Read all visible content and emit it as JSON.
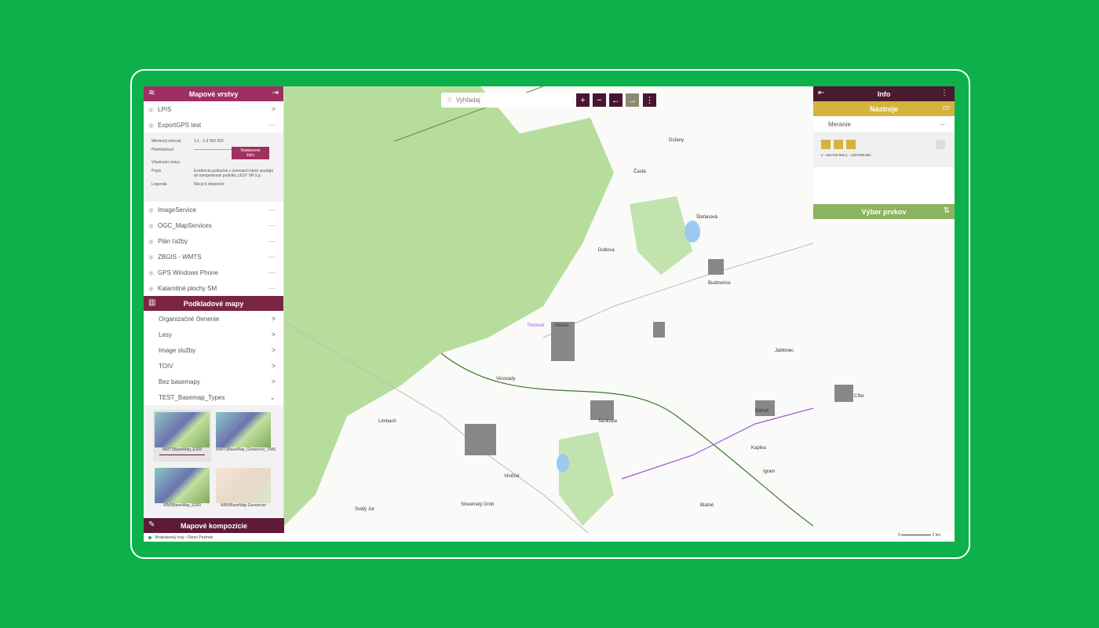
{
  "left": {
    "layers_title": "Mapové vrstvy",
    "layers": [
      {
        "label": "LPIS",
        "action": ">"
      },
      {
        "label": "ExportGPS test",
        "action": "···"
      }
    ],
    "detail": {
      "scale_label": "Mierkový interval",
      "scale_value": "1:1 - 1:3 000 000",
      "opacity_label": "Priehľadnosť",
      "settings_button": "Nastavenie štýlu",
      "props_label": "Vlastnosti vrstvy",
      "desc_label": "Popis",
      "desc_value": "Evidencia požiarísk v územiach ktoré spadajú do kompetencie podniku LESY SR š.p.",
      "legend_label": "Legenda",
      "legend_value": "Nie je k dispozícii",
      "opacity": 0.95
    },
    "layers2": [
      {
        "label": "ImageService"
      },
      {
        "label": "OGC_MapServices"
      },
      {
        "label": "Plán ťažby"
      },
      {
        "label": "ZBGIS - WMTS"
      },
      {
        "label": "GPS Windows Phone"
      },
      {
        "label": "Kalamitné plochy SM"
      }
    ],
    "basemaps_title": "Podkladové mapy",
    "basemaps": [
      {
        "label": "Organizačné členenie",
        "action": ">"
      },
      {
        "label": "Lesy",
        "action": ">"
      },
      {
        "label": "Image služby",
        "action": ">"
      },
      {
        "label": "TOIV",
        "action": ">"
      },
      {
        "label": "Bez basemapy",
        "action": ">"
      },
      {
        "label": "TEST_Basemap_Types",
        "action": "⌄"
      }
    ],
    "thumbs": [
      "WMTSBaseMap_ESRI",
      "WMTSBaseMap_Geoserver_VMS",
      "WMSBaseMap_ESRI",
      "WMSBaseMap Geoserver"
    ],
    "compositions_title": "Mapové kompozície"
  },
  "map": {
    "search_placeholder": "Vyhľadaj",
    "zoom_in": "+",
    "zoom_out": "−",
    "back": "←",
    "forward": "→",
    "more": "⋮",
    "labels": [
      "Pezinok",
      "Modra",
      "Vinosady",
      "Limbach",
      "Budmerice",
      "Dubová",
      "Šenkvice",
      "Jablonec",
      "Báhoň",
      "Blatné",
      "Viničné",
      "Slovenský Grob",
      "Svätý Jur",
      "Častá",
      "Doľany",
      "Štefanová",
      "Kaplna",
      "Igram",
      "Cífer"
    ],
    "scale": {
      "start": "0",
      "end": "2 km"
    }
  },
  "status": {
    "breadcrumb": "Bratislavský kraj › Okres Pezinok"
  },
  "right": {
    "info_title": "Info",
    "tools_title": "Nástroje",
    "measure_label": "Meranie",
    "coords": "x: -561780.506 y: -1257938.591",
    "selection_title": "Výber prvkov"
  },
  "colors": {
    "layers_header": "#9e2f62",
    "basemaps_header": "#7a2545",
    "info_header": "#4a1a2e",
    "tools_header": "#d4b33f",
    "selection_header": "#8cb35f",
    "background": "#0db14b"
  }
}
